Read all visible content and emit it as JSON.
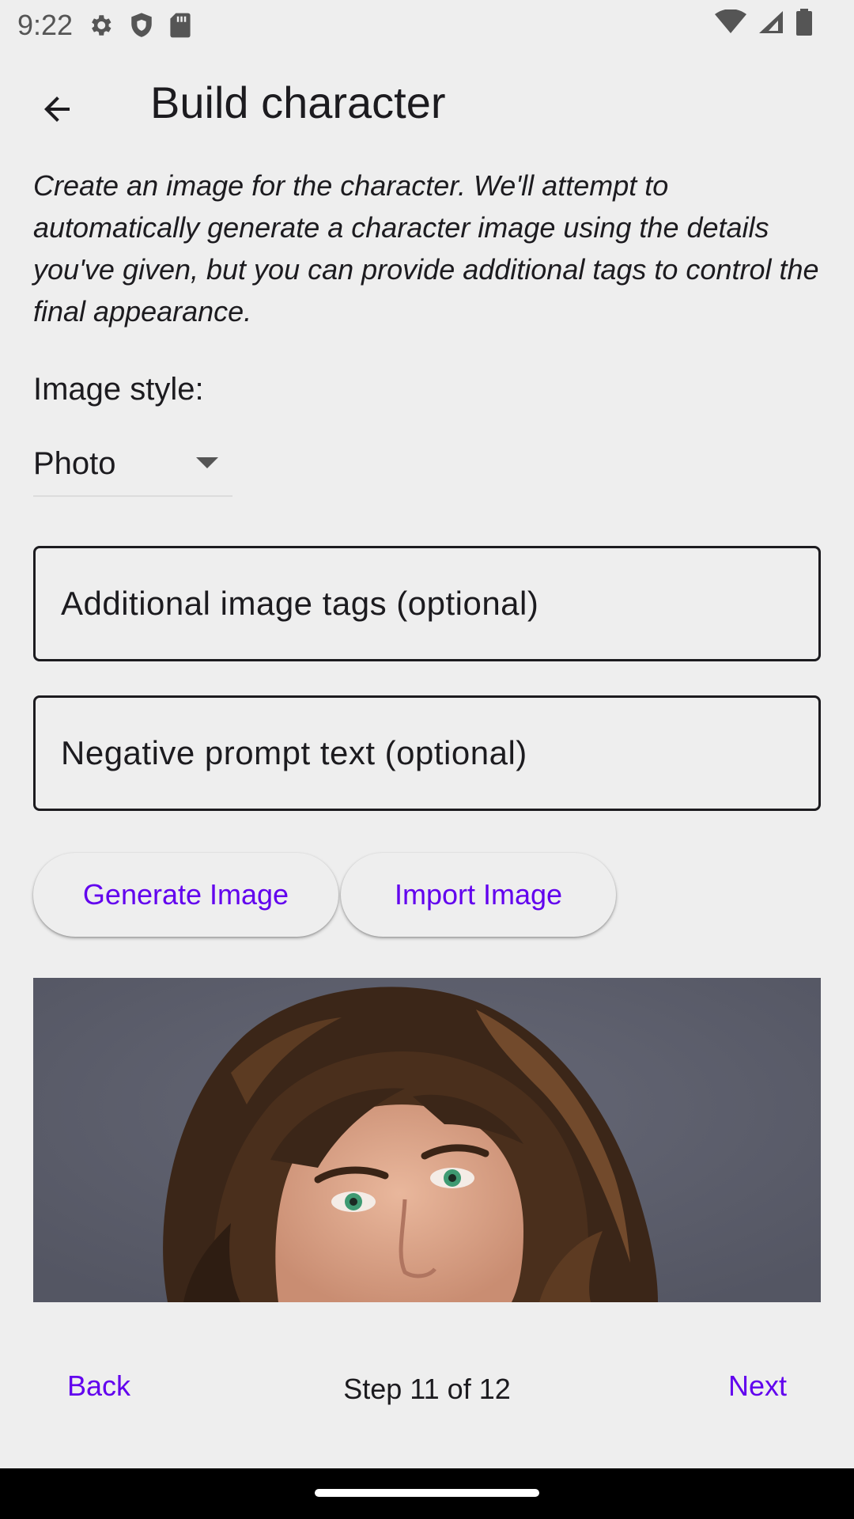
{
  "status_bar": {
    "time": "9:22",
    "icons_left": [
      "gear-icon",
      "shield-icon",
      "sd-card-icon"
    ],
    "icons_right": [
      "wifi-icon",
      "signal-icon",
      "battery-icon"
    ]
  },
  "app_bar": {
    "title": "Build character",
    "back_icon": "arrow-back-icon"
  },
  "description": "Create an image for the character. We'll attempt to automatically generate a character image using the details you've given, but you can provide additional tags to control the final appearance.",
  "image_style": {
    "label": "Image style:",
    "selected": "Photo"
  },
  "fields": {
    "tags_placeholder": "Additional image tags (optional)",
    "tags_value": "",
    "negative_placeholder": "Negative prompt text (optional)",
    "negative_value": ""
  },
  "actions": {
    "generate_label": "Generate Image",
    "import_label": "Import Image"
  },
  "bottom_nav": {
    "back_label": "Back",
    "step_text": "Step 11 of 12",
    "next_label": "Next"
  },
  "colors": {
    "background": "#eeeeee",
    "accent": "#6200ee",
    "text": "#1c1b1f"
  }
}
